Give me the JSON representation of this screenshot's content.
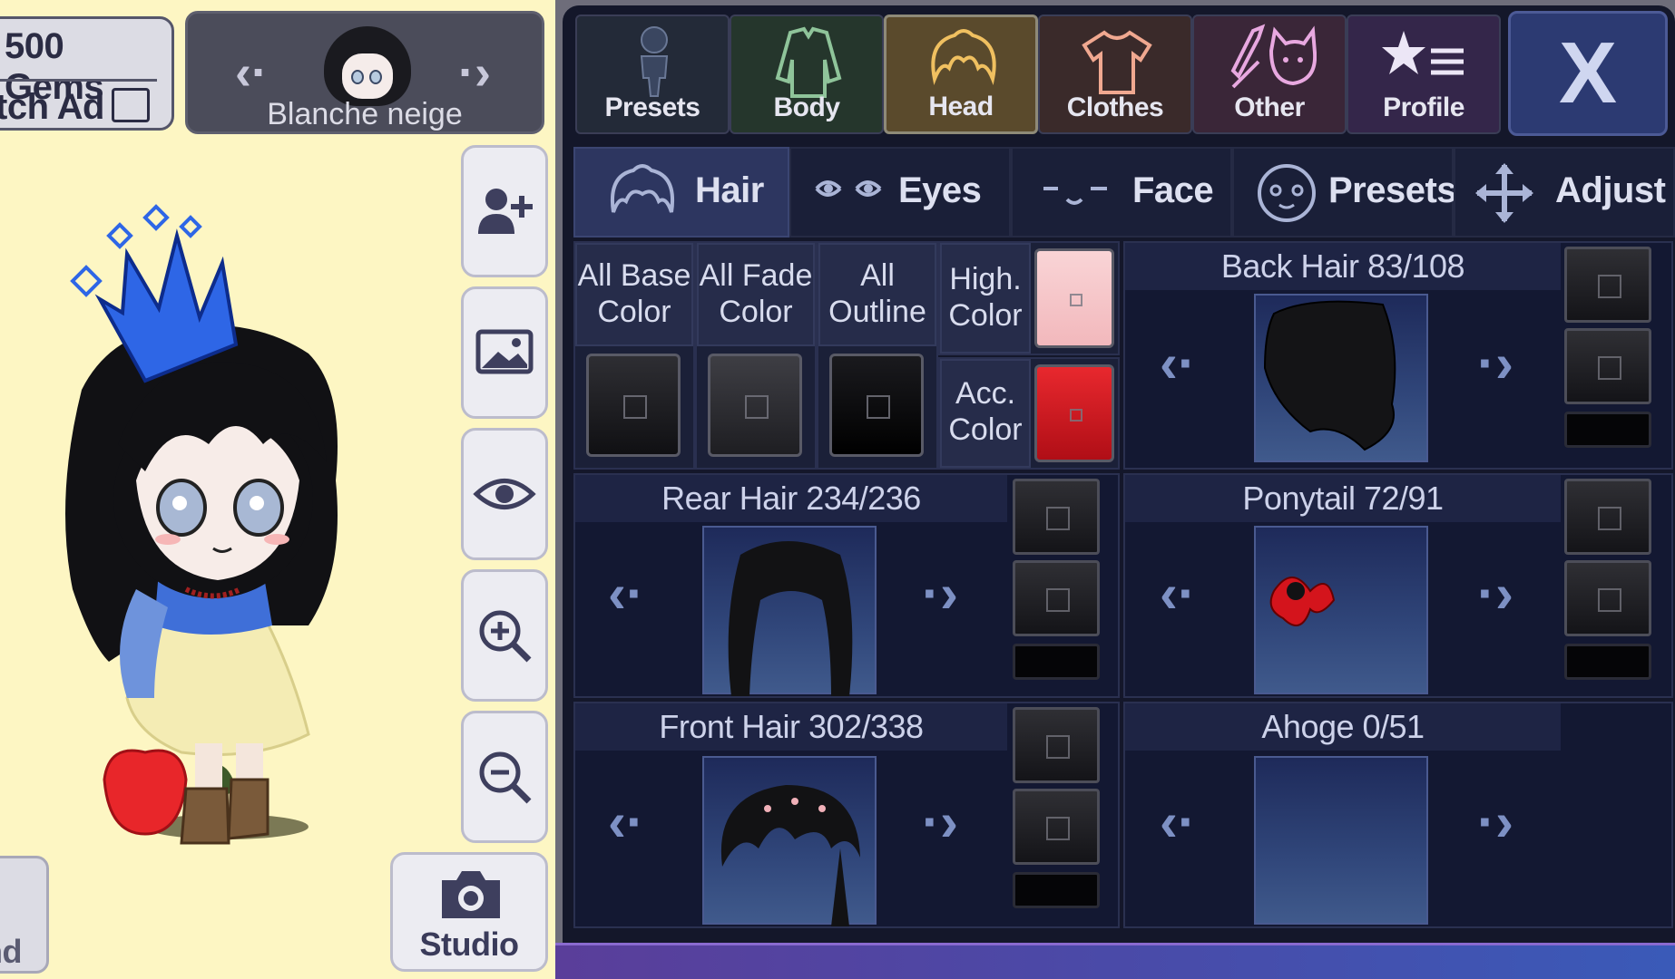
{
  "currency": {
    "gems": "500 Gems",
    "watch_ad": "tch Ad"
  },
  "character_selector": {
    "name": "Blanche neige"
  },
  "side_buttons": [
    {
      "icon": "add-user-icon"
    },
    {
      "icon": "background-image-icon"
    },
    {
      "icon": "eye-icon"
    },
    {
      "icon": "zoom-in-icon"
    },
    {
      "icon": "zoom-out-icon"
    }
  ],
  "studio_label": "Studio",
  "and_label": "nd",
  "top_tabs": [
    {
      "label": "Presets",
      "icon": "body-figure-icon"
    },
    {
      "label": "Body",
      "icon": "jacket-icon"
    },
    {
      "label": "Head",
      "icon": "hair-icon",
      "active": true
    },
    {
      "label": "Clothes",
      "icon": "shirt-icon"
    },
    {
      "label": "Other",
      "icon": "sword-cat-icon"
    },
    {
      "label": "Profile",
      "icon": "star-list-icon"
    }
  ],
  "close_label": "X",
  "sub_tabs": [
    {
      "label": "Hair",
      "icon": "hair-icon",
      "active": true
    },
    {
      "label": "Eyes",
      "icon": "eyes-icon"
    },
    {
      "label": "Face",
      "icon": "face-icon"
    },
    {
      "label": "Presets",
      "icon": "face-preset-icon"
    },
    {
      "label": "Adjust",
      "icon": "move-arrows-icon"
    }
  ],
  "colors": {
    "all_base": {
      "line1": "All Base",
      "line2": "Color",
      "swatch": "#1c1c1f"
    },
    "all_fade": {
      "line1": "All Fade",
      "line2": "Color",
      "swatch": "#2a2a2e"
    },
    "all_outline": {
      "line1": "All",
      "line2": "Outline",
      "swatch": "#0a0a0c"
    },
    "highlight": {
      "line1": "High.",
      "line2": "Color",
      "swatch": "#f6c6c8"
    },
    "accessory": {
      "line1": "Acc.",
      "line2": "Color",
      "swatch": "#d0121a"
    }
  },
  "items": {
    "back_hair": {
      "title": "Back Hair 83/108",
      "current": 83,
      "total": 108
    },
    "rear_hair": {
      "title": "Rear Hair 234/236",
      "current": 234,
      "total": 236
    },
    "ponytail": {
      "title": "Ponytail 72/91",
      "current": 72,
      "total": 91
    },
    "front_hair": {
      "title": "Front Hair 302/338",
      "current": 302,
      "total": 338
    },
    "ahoge": {
      "title": "Ahoge 0/51",
      "current": 0,
      "total": 51
    }
  }
}
